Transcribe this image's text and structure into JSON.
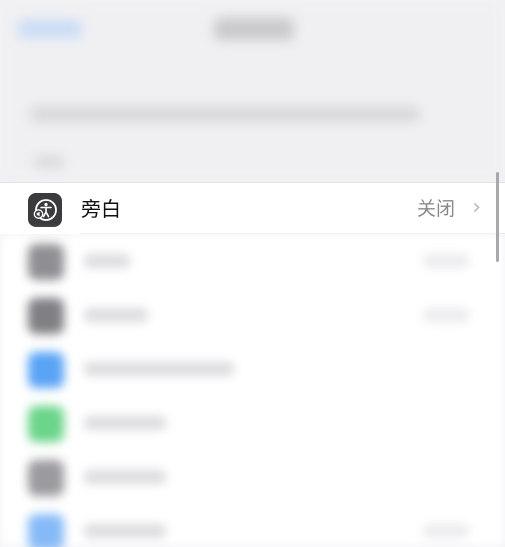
{
  "focused_row": {
    "label": "旁白",
    "value": "关闭",
    "chevron": "›",
    "icon": "accessibility-voiceover-icon"
  },
  "colors": {
    "background": "#f2f2f7",
    "row_background": "#ffffff",
    "icon_background": "#3b3b3d",
    "value_text": "#8a8a8e"
  }
}
